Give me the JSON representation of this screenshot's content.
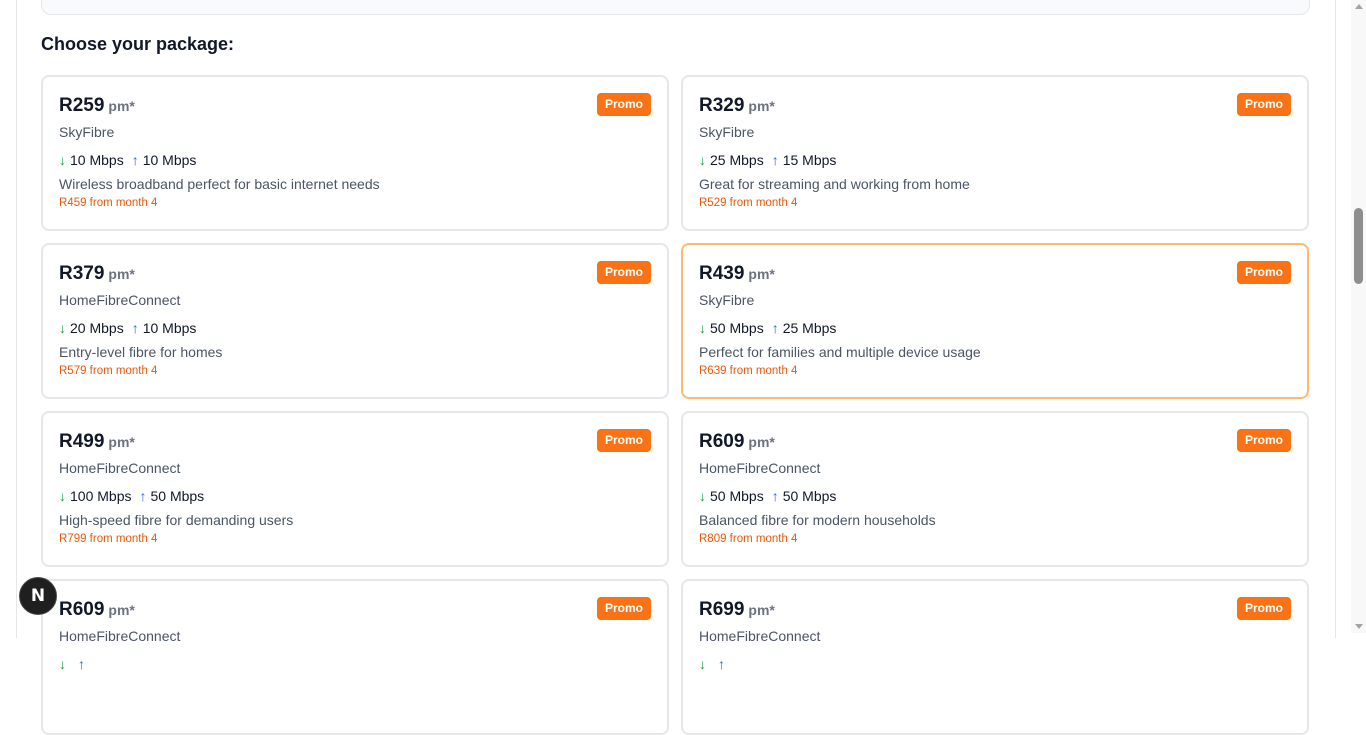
{
  "section_title": "Choose your package:",
  "currency_suffix": "pm*",
  "badge_label": "Promo",
  "fab": {
    "label": "N"
  },
  "colors": {
    "accent": "#f97316",
    "promo_text": "#ea580c",
    "down_arrow": "#16a34a",
    "up_arrow": "#2563eb"
  },
  "packages": [
    {
      "price": "R259",
      "provider": "SkyFibre",
      "download": "10 Mbps",
      "upload": "10 Mbps",
      "description": "Wireless broadband perfect for basic internet needs",
      "promo_note": "R459 from month 4"
    },
    {
      "price": "R329",
      "provider": "SkyFibre",
      "download": "25 Mbps",
      "upload": "15 Mbps",
      "description": "Great for streaming and working from home",
      "promo_note": "R529 from month 4"
    },
    {
      "price": "R379",
      "provider": "HomeFibreConnect",
      "download": "20 Mbps",
      "upload": "10 Mbps",
      "description": "Entry-level fibre for homes",
      "promo_note": "R579 from month 4"
    },
    {
      "price": "R439",
      "provider": "SkyFibre",
      "download": "50 Mbps",
      "upload": "25 Mbps",
      "description": "Perfect for families and multiple device usage",
      "promo_note": "R639 from month 4",
      "selected": true
    },
    {
      "price": "R499",
      "provider": "HomeFibreConnect",
      "download": "100 Mbps",
      "upload": "50 Mbps",
      "description": "High-speed fibre for demanding users",
      "promo_note": "R799 from month 4"
    },
    {
      "price": "R609",
      "provider": "HomeFibreConnect",
      "download": "50 Mbps",
      "upload": "50 Mbps",
      "description": "Balanced fibre for modern households",
      "promo_note": "R809 from month 4"
    },
    {
      "price": "R609",
      "provider": "HomeFibreConnect",
      "download": "",
      "upload": "",
      "description": "",
      "promo_note": ""
    },
    {
      "price": "R699",
      "provider": "HomeFibreConnect",
      "download": "",
      "upload": "",
      "description": "",
      "promo_note": ""
    }
  ]
}
